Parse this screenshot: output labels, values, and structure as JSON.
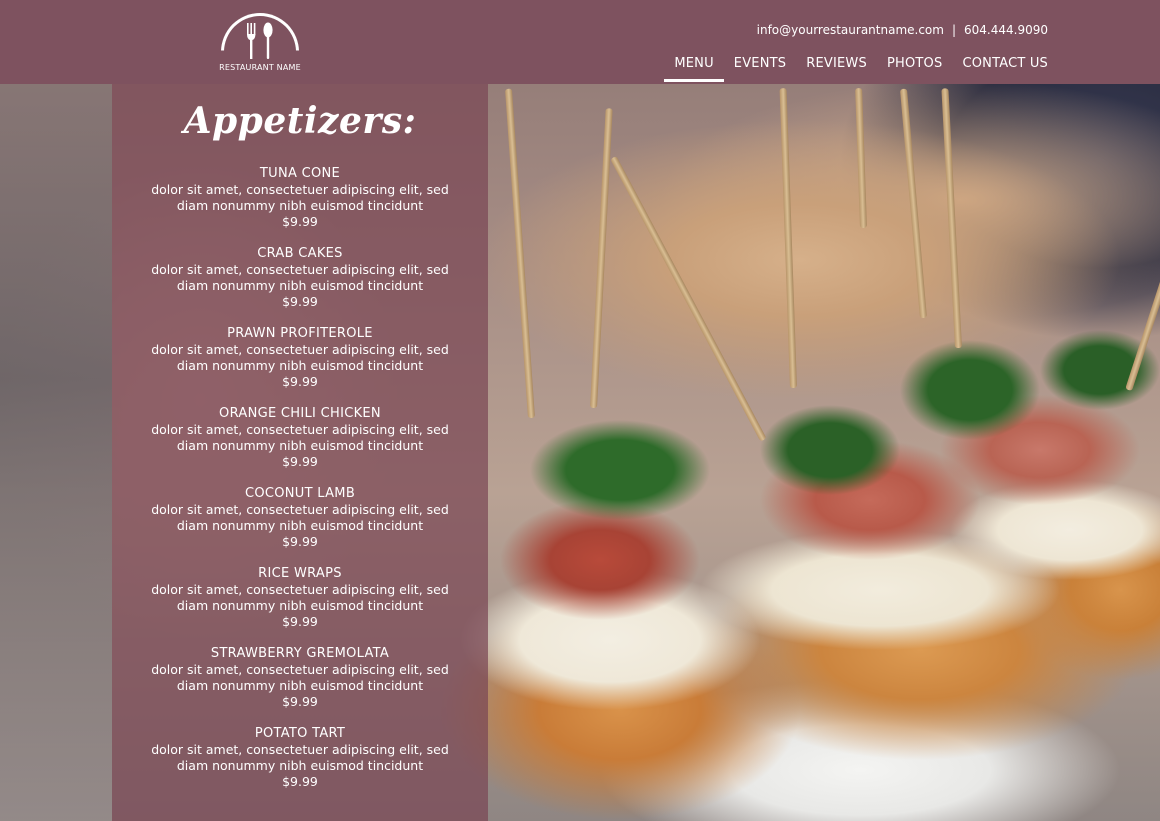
{
  "header": {
    "logo_text": "RESTAURANT NAME",
    "email": "info@yourrestaurantname.com",
    "separator": "|",
    "phone": "604.444.9090",
    "nav": [
      {
        "label": "MENU",
        "active": true
      },
      {
        "label": "EVENTS",
        "active": false
      },
      {
        "label": "REVIEWS",
        "active": false
      },
      {
        "label": "PHOTOS",
        "active": false
      },
      {
        "label": "CONTACT US",
        "active": false
      }
    ]
  },
  "menu": {
    "title": "Appetizers:",
    "items": [
      {
        "name": "TUNA CONE",
        "desc1": "dolor sit amet, consectetuer adipiscing elit, sed",
        "desc2": "diam nonummy nibh euismod tincidunt",
        "price": "$9.99"
      },
      {
        "name": "CRAB CAKES",
        "desc1": "dolor sit amet, consectetuer adipiscing elit, sed",
        "desc2": "diam nonummy nibh euismod tincidunt",
        "price": "$9.99"
      },
      {
        "name": "PRAWN PROFITEROLE",
        "desc1": "dolor sit amet, consectetuer adipiscing elit, sed",
        "desc2": "diam nonummy nibh euismod tincidunt",
        "price": "$9.99"
      },
      {
        "name": "ORANGE CHILI CHICKEN",
        "desc1": "dolor sit amet, consectetuer adipiscing elit, sed",
        "desc2": "diam nonummy nibh euismod tincidunt",
        "price": "$9.99"
      },
      {
        "name": "COCONUT LAMB",
        "desc1": "dolor sit amet, consectetuer adipiscing elit, sed",
        "desc2": "diam nonummy nibh euismod tincidunt",
        "price": "$9.99"
      },
      {
        "name": "RICE WRAPS",
        "desc1": "dolor sit amet, consectetuer adipiscing elit, sed",
        "desc2": "diam nonummy nibh euismod tincidunt",
        "price": "$9.99"
      },
      {
        "name": "STRAWBERRY GREMOLATA",
        "desc1": "dolor sit amet, consectetuer adipiscing elit, sed",
        "desc2": "diam nonummy nibh euismod tincidunt",
        "price": "$9.99"
      },
      {
        "name": "POTATO TART",
        "desc1": "dolor sit amet, consectetuer adipiscing elit, sed",
        "desc2": "diam nonummy nibh euismod tincidunt",
        "price": "$9.99"
      }
    ]
  },
  "background": {
    "subject": "appetizer-photo",
    "header_color": "#7e525f",
    "panel_color": "#7a4655"
  }
}
